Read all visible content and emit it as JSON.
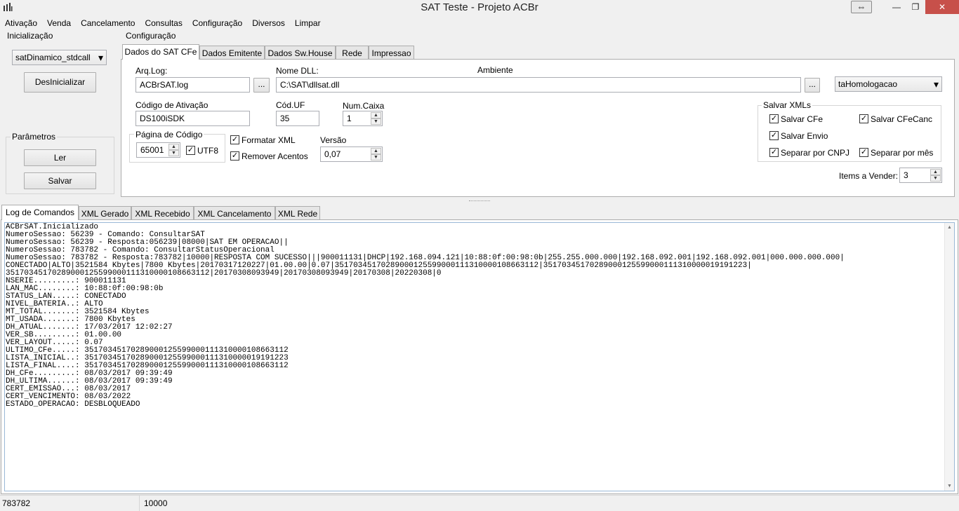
{
  "window": {
    "title": "SAT Teste - Projeto ACBr"
  },
  "menu": [
    "Ativação",
    "Venda",
    "Cancelamento",
    "Consultas",
    "Configuração",
    "Diversos",
    "Limpar"
  ],
  "inicializacao": {
    "label": "Inicialização",
    "model_select": "satDinamico_stdcall",
    "deinit_button": "DesInicializar"
  },
  "parametros": {
    "label": "Parâmetros",
    "read_button": "Ler",
    "save_button": "Salvar"
  },
  "configuracao": {
    "label": "Configuração",
    "tabs": [
      "Dados do SAT CFe",
      "Dados Emitente",
      "Dados Sw.House",
      "Rede",
      "Impressao"
    ],
    "arqlog_label": "Arq.Log:",
    "arqlog_value": "ACBrSAT.log",
    "browse_label": "...",
    "nomedll_label": "Nome DLL:",
    "nomedll_value": "C:\\SAT\\dllsat.dll",
    "ambiente_label": "Ambiente",
    "ambiente_value": "taHomologacao",
    "codativ_label": "Código de Ativação",
    "codativ_value": "DS100iSDK",
    "coduf_label": "Cód.UF",
    "coduf_value": "35",
    "numcaixa_label": "Num.Caixa",
    "numcaixa_value": "1",
    "paginacod_label": "Página de Código",
    "paginacod_value": "65001",
    "utf8_label": "UTF8",
    "formatar_label": "Formatar XML",
    "remover_label": "Remover Acentos",
    "versao_label": "Versão",
    "versao_value": "0,07",
    "salvarxml_label": "Salvar XMLs",
    "salvar_cfe": "Salvar CFe",
    "salvar_cfecanc": "Salvar CFeCanc",
    "salvar_envio": "Salvar Envio",
    "separar_cnpj": "Separar por CNPJ",
    "separar_mes": "Separar por mês",
    "items_label": "Items a Vender:",
    "items_value": "3",
    "check_mark": "✓"
  },
  "log_tabs": [
    "Log de Comandos",
    "XML Gerado",
    "XML Recebido",
    "XML Cancelamento",
    "XML Rede"
  ],
  "log_text": "ACBrSAT.Inicializado\nNumeroSessao: 56239 - Comando: ConsultarSAT\nNumeroSessao: 56239 - Resposta:056239|08000|SAT EM OPERACAO||\nNumeroSessao: 783782 - Comando: ConsultarStatusOperacional\nNumeroSessao: 783782 - Resposta:783782|10000|RESPOSTA COM SUCESSO|||900011131|DHCP|192.168.094.121|10:88:0f:00:98:0b|255.255.000.000|192.168.092.001|192.168.092.001|000.000.000.000|\nCONECTADO|ALTO|3521584 Kbytes|7800 Kbytes|20170317120227|01.00.00|0.07|35170345170289000125599000111310000108663112|35170345170289000125599000111310000019191223|\n35170345170289000125599000111310000108663112|20170308093949|20170308093949|20170308|20220308|0\nNSERIE.........: 900011131\nLAN_MAC........: 10:88:0f:00:98:0b\nSTATUS_LAN.....: CONECTADO\nNIVEL_BATERIA..: ALTO\nMT_TOTAL.......: 3521584 Kbytes\nMT_USADA.......: 7800 Kbytes\nDH_ATUAL.......: 17/03/2017 12:02:27\nVER_SB.........: 01.00.00\nVER_LAYOUT.....: 0.07\nULTIMO_CFe.....: 35170345170289000125599000111310000108663112\nLISTA_INICIAL..: 35170345170289000125599000111310000019191223\nLISTA_FINAL....: 35170345170289000125599000111310000108663112\nDH_CFe.........: 08/03/2017 09:39:49\nDH_ULTIMA......: 08/03/2017 09:39:49\nCERT_EMISSAO...: 08/03/2017\nCERT_VENCIMENTO: 08/03/2022\nESTADO_OPERACAO: DESBLOQUEADO",
  "status": {
    "left": "783782",
    "right": "10000"
  },
  "icons": {
    "up": "▲",
    "down": "▼",
    "dropdown": "▾",
    "minimize": "—",
    "maximize": "❐",
    "close": "✕",
    "restore_ext": "⇔"
  }
}
